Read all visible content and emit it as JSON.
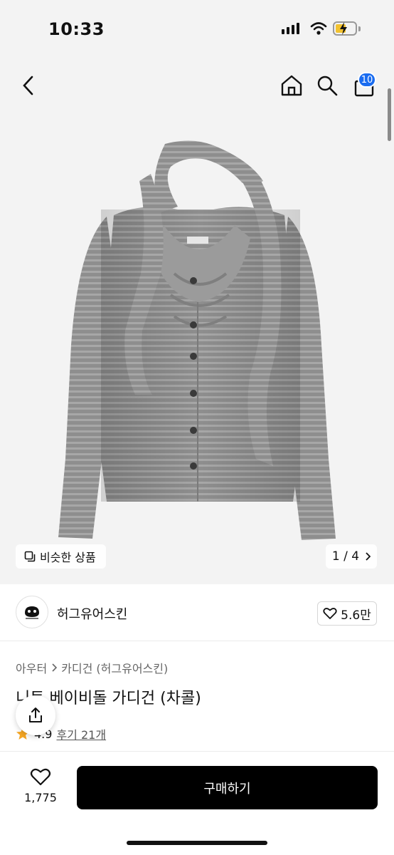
{
  "status_bar": {
    "time": "10:33"
  },
  "cart": {
    "badge_count": "10"
  },
  "gallery": {
    "similar_label": "비슷한 상품",
    "page_indicator": "1 / 4"
  },
  "brand": {
    "name": "허그유어스킨",
    "likes": "5.6만"
  },
  "breadcrumb": {
    "parent": "아우터",
    "category": "카디건 (허그유어스킨)"
  },
  "product": {
    "title": "니트 베이비돌 가디건 (차콜)",
    "rating": "4.9",
    "review_label": "후기 21개"
  },
  "actions": {
    "wish_count": "1,775",
    "buy_label": "구매하기"
  },
  "colors": {
    "accent": "#1a6cf0",
    "buy_bg": "#000000",
    "star": "#f5a623"
  },
  "icons": [
    "back-icon",
    "home-icon",
    "search-icon",
    "cart-icon",
    "copy-icon",
    "chevron-right-icon",
    "heart-icon",
    "share-icon",
    "star-icon"
  ]
}
